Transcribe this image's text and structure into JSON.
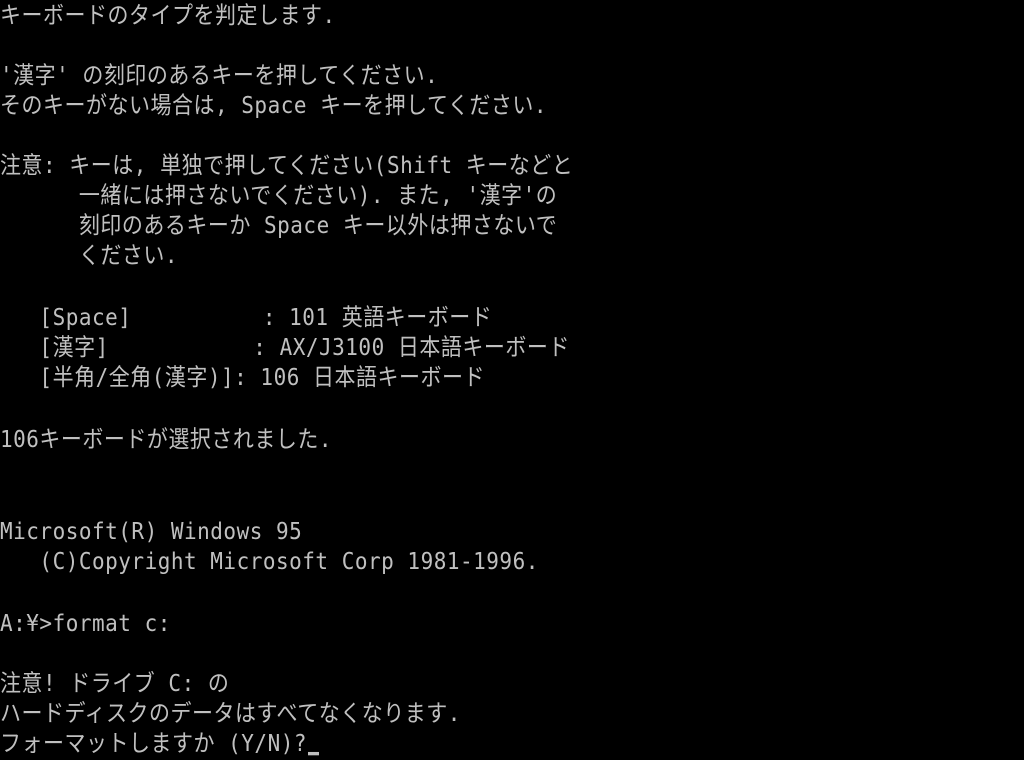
{
  "colors": {
    "background": "#000000",
    "text": "#c0c0c0"
  },
  "keyboard_detection": {
    "intro": "キーボードのタイプを判定します.",
    "instruction_1": "'漢字' の刻印のあるキーを押してください.",
    "instruction_2": "そのキーがない場合は, Space キーを押してください.",
    "caution_1": "注意: キーは, 単独で押してください(Shift キーなどと",
    "caution_2": "      一緒には押さないでください). また, '漢字'の",
    "caution_3": "      刻印のあるキーか Space キー以外は押さないで",
    "caution_4": "      ください.",
    "options": [
      {
        "text": "   [Space]          : 101 英語キーボード"
      },
      {
        "text": "   [漢字]           : AX/J3100 日本語キーボード"
      },
      {
        "text": "   [半角/全角(漢字)]: 106 日本語キーボード"
      }
    ],
    "result": "106キーボードが選択されました."
  },
  "os_banner": {
    "product": "Microsoft(R) Windows 95",
    "copyright": "   (C)Copyright Microsoft Corp 1981-1996."
  },
  "command": {
    "prompt_line": "A:¥>format c:"
  },
  "format_warning": {
    "line_1": "注意! ドライブ C: の",
    "line_2": "ハードディスクのデータはすべてなくなります.",
    "confirm_prompt": "フォーマットしますか (Y/N)?"
  }
}
